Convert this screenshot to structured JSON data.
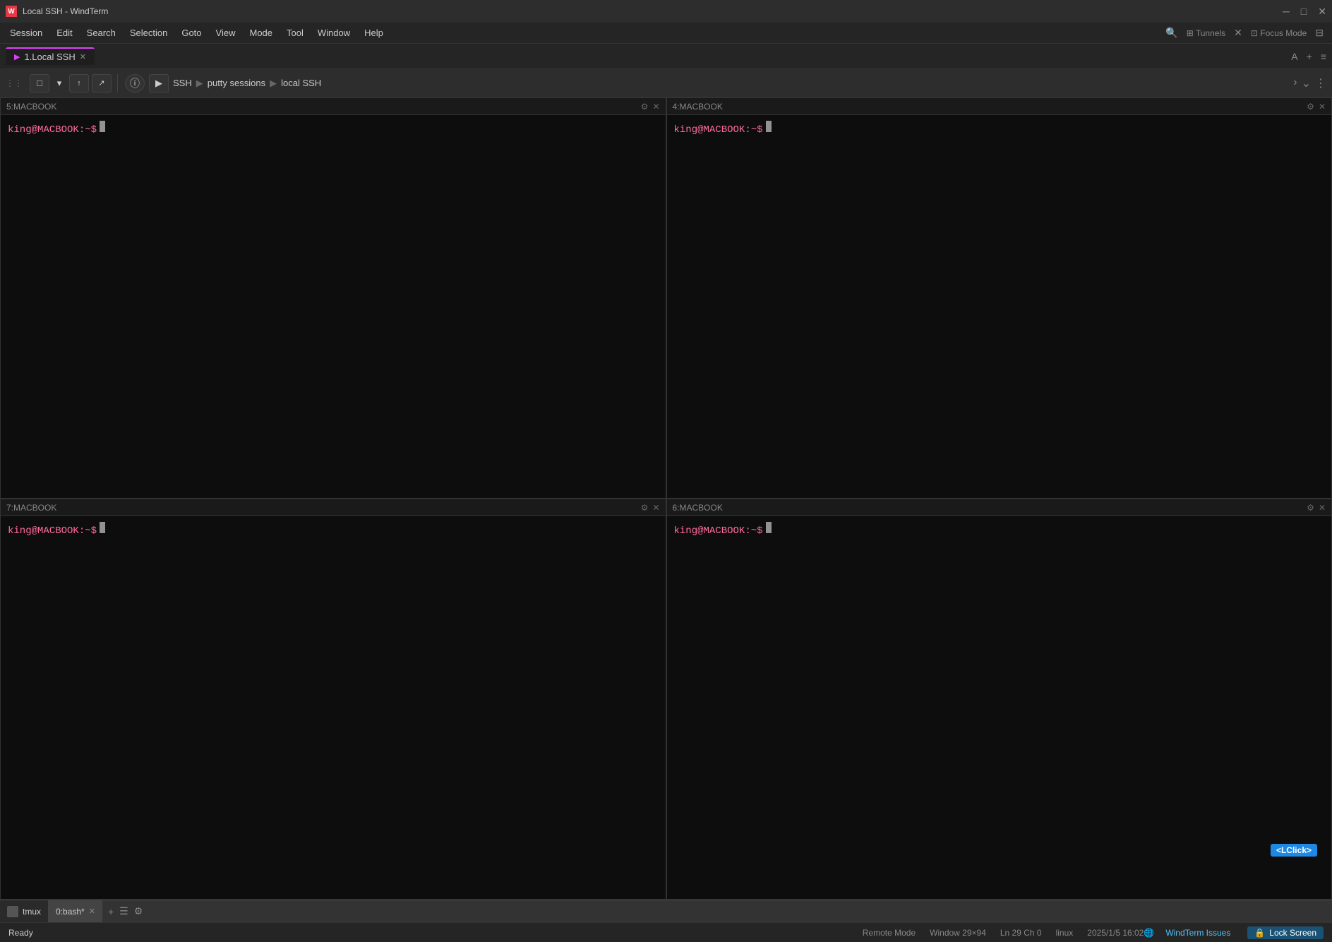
{
  "titleBar": {
    "appName": "Local SSH - WindTerm",
    "iconText": "W",
    "controls": {
      "minimize": "─",
      "maximize": "□",
      "close": "✕"
    }
  },
  "menuBar": {
    "items": [
      "Session",
      "Edit",
      "Search",
      "Selection",
      "Goto",
      "View",
      "Mode",
      "Tool",
      "Window",
      "Help"
    ]
  },
  "tabBar": {
    "tabs": [
      {
        "icon": "▶",
        "label": "1.Local SSH",
        "closable": true
      }
    ],
    "actions": {
      "font": "A",
      "add": "+",
      "more": "≡"
    }
  },
  "toolbar": {
    "buttons": [
      "□",
      "▾",
      "↑",
      "↗"
    ],
    "infoBtn": "ⓘ",
    "playBtn": "▶",
    "breadcrumb": [
      "SSH",
      "putty sessions",
      "local SSH"
    ],
    "chevronRight": "›",
    "chevronDown": "⌄",
    "moreBtn": "⋮"
  },
  "panes": [
    {
      "id": "pane-5",
      "title": "5:MACBOOK",
      "prompt": "king@MACBOOK:~$"
    },
    {
      "id": "pane-4",
      "title": "4:MACBOOK",
      "prompt": "king@MACBOOK:~$"
    },
    {
      "id": "pane-7",
      "title": "7:MACBOOK",
      "prompt": "king@MACBOOK:~$"
    },
    {
      "id": "pane-6",
      "title": "6:MACBOOK",
      "prompt": "king@MACBOOK:~$"
    }
  ],
  "tmuxBar": {
    "logoLabel": "tmux",
    "windows": [
      {
        "label": "0:bash*",
        "active": true,
        "closable": true
      }
    ],
    "addBtn": "+",
    "listBtn": "☰",
    "settingsBtn": "⚙"
  },
  "statusBar": {
    "ready": "Ready",
    "remoteMode": "Remote Mode",
    "windowSize": "Window 29×94",
    "cursorPos": "Ln 29 Ch 0",
    "osType": "linux",
    "datetime": "2025/1/5 16:02",
    "issues": "WindTerm Issues",
    "lockScreen": "Lock Screen",
    "lclickBadge": "<LClick>"
  }
}
